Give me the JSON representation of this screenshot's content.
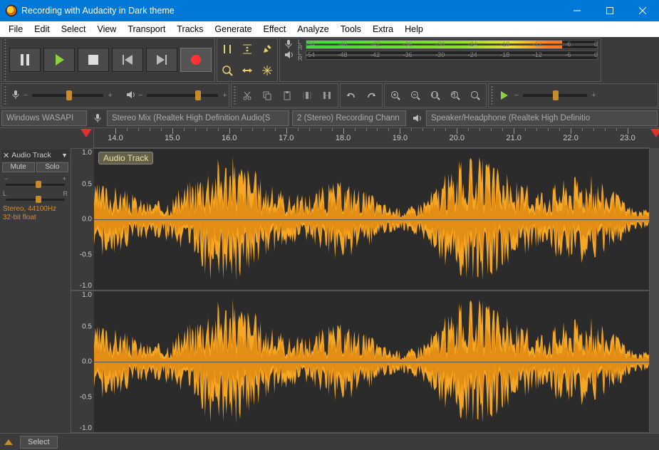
{
  "window": {
    "title": "Recording with Audacity in Dark theme"
  },
  "menu": [
    "File",
    "Edit",
    "Select",
    "View",
    "Transport",
    "Tracks",
    "Generate",
    "Effect",
    "Analyze",
    "Tools",
    "Extra",
    "Help"
  ],
  "meter_ticks": [
    "-54",
    "-48",
    "-42",
    "-36",
    "-30",
    "-24",
    "-18",
    "-12",
    "-6",
    "0"
  ],
  "devices": {
    "host": "Windows WASAPI",
    "rec_device": "Stereo Mix (Realtek High Definition Audio(S",
    "rec_channels": "2 (Stereo) Recording Chann",
    "play_device": "Speaker/Headphone (Realtek High Definitio"
  },
  "timeline": {
    "start": 14.0,
    "end": 23.0,
    "step": 1.0,
    "labels": [
      "14.0",
      "15.0",
      "16.0",
      "17.0",
      "18.0",
      "19.0",
      "20.0",
      "21.0",
      "22.0",
      "23.0"
    ]
  },
  "track": {
    "menu_name": "Audio Track",
    "mute": "Mute",
    "solo": "Solo",
    "info1": "Stereo, 44100Hz",
    "info2": "32-bit float",
    "clip_label": "Audio Track"
  },
  "vscale": [
    "1.0",
    "0.5",
    "0.0",
    "-0.5",
    "-1.0"
  ],
  "bottom": {
    "select": "Select"
  }
}
